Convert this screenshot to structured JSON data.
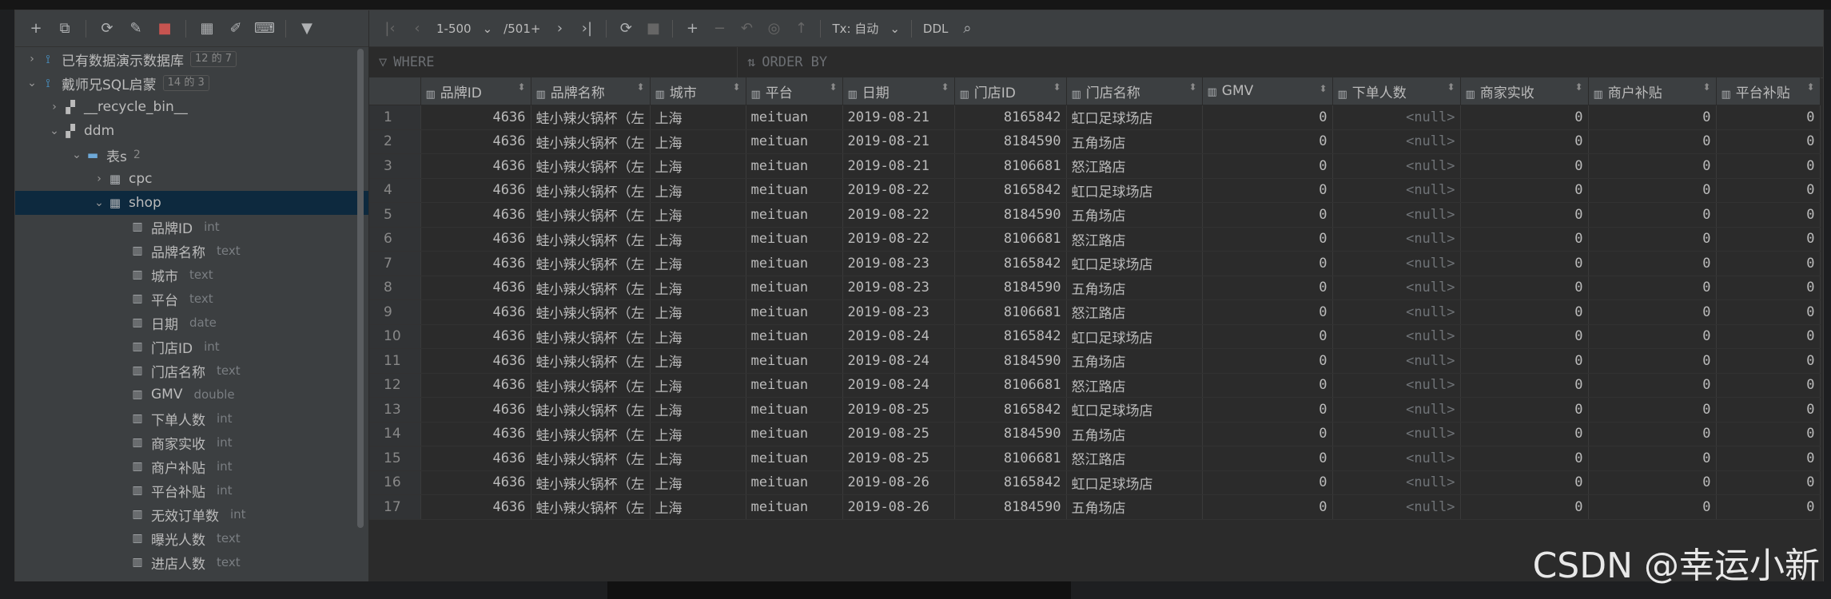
{
  "sidebar": {
    "toolbar": [
      {
        "icon": "add-icon",
        "label": "+"
      },
      {
        "icon": "copy-icon",
        "label": "⧉"
      },
      {
        "icon": "refresh-icon",
        "label": "⟳"
      },
      {
        "icon": "edit-icon",
        "label": "✎"
      },
      {
        "icon": "stop-icon",
        "label": "■"
      },
      {
        "icon": "table-icon",
        "label": "▦"
      },
      {
        "icon": "pencil-icon",
        "label": "✐"
      },
      {
        "icon": "console-icon",
        "label": "⌨"
      },
      {
        "icon": "filter-icon",
        "label": "▼"
      }
    ],
    "tree": [
      {
        "depth": 0,
        "arrow": "›",
        "icon": "db",
        "label": "已有数据演示数据库",
        "badge": "12 的 7"
      },
      {
        "depth": 0,
        "arrow": "⌄",
        "icon": "db",
        "label": "戴师兄SQL启蒙",
        "badge": "14 的 3"
      },
      {
        "depth": 1,
        "arrow": "›",
        "icon": "schema",
        "label": "__recycle_bin__"
      },
      {
        "depth": 1,
        "arrow": "⌄",
        "icon": "schema",
        "label": "ddm"
      },
      {
        "depth": 2,
        "arrow": "⌄",
        "icon": "folder",
        "label": "表s",
        "count": "2"
      },
      {
        "depth": 3,
        "arrow": "›",
        "icon": "table",
        "label": "cpc"
      },
      {
        "depth": 3,
        "arrow": "⌄",
        "icon": "table",
        "label": "shop",
        "selected": true
      },
      {
        "depth": 4,
        "icon": "col",
        "label": "品牌ID",
        "type": "int"
      },
      {
        "depth": 4,
        "icon": "col",
        "label": "品牌名称",
        "type": "text"
      },
      {
        "depth": 4,
        "icon": "col",
        "label": "城市",
        "type": "text"
      },
      {
        "depth": 4,
        "icon": "col",
        "label": "平台",
        "type": "text"
      },
      {
        "depth": 4,
        "icon": "col",
        "label": "日期",
        "type": "date"
      },
      {
        "depth": 4,
        "icon": "col",
        "label": "门店ID",
        "type": "int"
      },
      {
        "depth": 4,
        "icon": "col",
        "label": "门店名称",
        "type": "text"
      },
      {
        "depth": 4,
        "icon": "col",
        "label": "GMV",
        "type": "double"
      },
      {
        "depth": 4,
        "icon": "col",
        "label": "下单人数",
        "type": "int"
      },
      {
        "depth": 4,
        "icon": "col",
        "label": "商家实收",
        "type": "int"
      },
      {
        "depth": 4,
        "icon": "col",
        "label": "商户补贴",
        "type": "int"
      },
      {
        "depth": 4,
        "icon": "col",
        "label": "平台补贴",
        "type": "int"
      },
      {
        "depth": 4,
        "icon": "col",
        "label": "无效订单数",
        "type": "int"
      },
      {
        "depth": 4,
        "icon": "col",
        "label": "曝光人数",
        "type": "text"
      },
      {
        "depth": 4,
        "icon": "col",
        "label": "进店人数",
        "type": "text"
      }
    ]
  },
  "results": {
    "toolbar": {
      "range": "1-500",
      "total": "/501+",
      "tx_label": "Tx: 自动",
      "ddl_label": "DDL"
    },
    "where_label": "WHERE",
    "orderby_label": "ORDER BY",
    "columns": [
      "品牌ID",
      "品牌名称",
      "城市",
      "平台",
      "日期",
      "门店ID",
      "门店名称",
      "GMV",
      "下单人数",
      "商家实收",
      "商户补贴",
      "平台补贴"
    ],
    "rows": [
      [
        "4636",
        "蛙小辣火锅杯（左",
        "上海",
        "meituan",
        "2019-08-21",
        "8165842",
        "虹口足球场店",
        "0",
        "<null>",
        "0",
        "0",
        "0"
      ],
      [
        "4636",
        "蛙小辣火锅杯（左",
        "上海",
        "meituan",
        "2019-08-21",
        "8184590",
        "五角场店",
        "0",
        "<null>",
        "0",
        "0",
        "0"
      ],
      [
        "4636",
        "蛙小辣火锅杯（左",
        "上海",
        "meituan",
        "2019-08-21",
        "8106681",
        "怒江路店",
        "0",
        "<null>",
        "0",
        "0",
        "0"
      ],
      [
        "4636",
        "蛙小辣火锅杯（左",
        "上海",
        "meituan",
        "2019-08-22",
        "8165842",
        "虹口足球场店",
        "0",
        "<null>",
        "0",
        "0",
        "0"
      ],
      [
        "4636",
        "蛙小辣火锅杯（左",
        "上海",
        "meituan",
        "2019-08-22",
        "8184590",
        "五角场店",
        "0",
        "<null>",
        "0",
        "0",
        "0"
      ],
      [
        "4636",
        "蛙小辣火锅杯（左",
        "上海",
        "meituan",
        "2019-08-22",
        "8106681",
        "怒江路店",
        "0",
        "<null>",
        "0",
        "0",
        "0"
      ],
      [
        "4636",
        "蛙小辣火锅杯（左",
        "上海",
        "meituan",
        "2019-08-23",
        "8165842",
        "虹口足球场店",
        "0",
        "<null>",
        "0",
        "0",
        "0"
      ],
      [
        "4636",
        "蛙小辣火锅杯（左",
        "上海",
        "meituan",
        "2019-08-23",
        "8184590",
        "五角场店",
        "0",
        "<null>",
        "0",
        "0",
        "0"
      ],
      [
        "4636",
        "蛙小辣火锅杯（左",
        "上海",
        "meituan",
        "2019-08-23",
        "8106681",
        "怒江路店",
        "0",
        "<null>",
        "0",
        "0",
        "0"
      ],
      [
        "4636",
        "蛙小辣火锅杯（左",
        "上海",
        "meituan",
        "2019-08-24",
        "8165842",
        "虹口足球场店",
        "0",
        "<null>",
        "0",
        "0",
        "0"
      ],
      [
        "4636",
        "蛙小辣火锅杯（左",
        "上海",
        "meituan",
        "2019-08-24",
        "8184590",
        "五角场店",
        "0",
        "<null>",
        "0",
        "0",
        "0"
      ],
      [
        "4636",
        "蛙小辣火锅杯（左",
        "上海",
        "meituan",
        "2019-08-24",
        "8106681",
        "怒江路店",
        "0",
        "<null>",
        "0",
        "0",
        "0"
      ],
      [
        "4636",
        "蛙小辣火锅杯（左",
        "上海",
        "meituan",
        "2019-08-25",
        "8165842",
        "虹口足球场店",
        "0",
        "<null>",
        "0",
        "0",
        "0"
      ],
      [
        "4636",
        "蛙小辣火锅杯（左",
        "上海",
        "meituan",
        "2019-08-25",
        "8184590",
        "五角场店",
        "0",
        "<null>",
        "0",
        "0",
        "0"
      ],
      [
        "4636",
        "蛙小辣火锅杯（左",
        "上海",
        "meituan",
        "2019-08-25",
        "8106681",
        "怒江路店",
        "0",
        "<null>",
        "0",
        "0",
        "0"
      ],
      [
        "4636",
        "蛙小辣火锅杯（左",
        "上海",
        "meituan",
        "2019-08-26",
        "8165842",
        "虹口足球场店",
        "0",
        "<null>",
        "0",
        "0",
        "0"
      ],
      [
        "4636",
        "蛙小辣火锅杯（左",
        "上海",
        "meituan",
        "2019-08-26",
        "8184590",
        "五角场店",
        "0",
        "<null>",
        "0",
        "0",
        "0"
      ]
    ]
  },
  "watermark": "CSDN @幸运小新"
}
